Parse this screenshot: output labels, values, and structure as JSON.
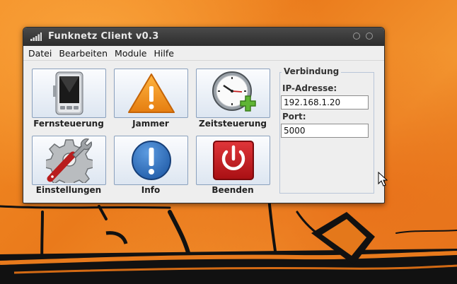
{
  "window": {
    "title": "Funknetz Client v0.3"
  },
  "menu": [
    "Datei",
    "Bearbeiten",
    "Module",
    "Hilfe"
  ],
  "modules": [
    {
      "label": "Fernsteuerung",
      "icon": "pda-device-icon"
    },
    {
      "label": "Jammer",
      "icon": "warning-triangle-icon"
    },
    {
      "label": "Zeitsteuerung",
      "icon": "clock-add-icon"
    },
    {
      "label": "Einstellungen",
      "icon": "gear-wrench-icon"
    },
    {
      "label": "Info",
      "icon": "info-icon"
    },
    {
      "label": "Beenden",
      "icon": "power-icon"
    }
  ],
  "connection": {
    "legend": "Verbindung",
    "ip_label": "IP-Adresse:",
    "ip_value": "192.168.1.20",
    "port_label": "Port:",
    "port_value": "5000"
  },
  "colors": {
    "titlebar": "#2d2d2d",
    "window_bg": "#eeeeee",
    "desktop_orange": "#ea7a1b",
    "button_border": "#8aa0bd"
  }
}
